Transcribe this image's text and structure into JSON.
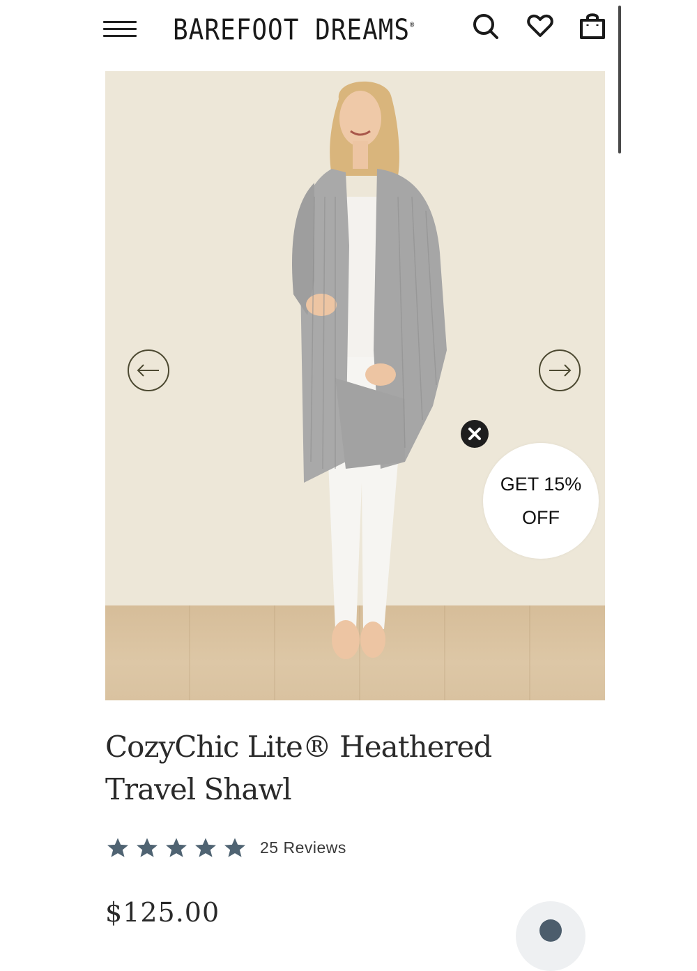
{
  "header": {
    "brand": "BAREFOOT DREAMS",
    "brand_mark": "®",
    "icons": [
      "menu-icon",
      "search-icon",
      "heart-icon",
      "shopping-bag-icon"
    ]
  },
  "hero": {
    "image_alt": "Model wearing CozyChic Lite Heathered Travel Shawl",
    "prev_icon": "arrow-left-icon",
    "next_icon": "arrow-right-icon"
  },
  "promo": {
    "line1": "GET 15%",
    "line2": "OFF",
    "close_icon": "close-icon"
  },
  "product": {
    "title": "CozyChic Lite® Heathered Travel Shawl",
    "rating_stars": 5,
    "reviews": "25 Reviews",
    "price": "$125.00"
  },
  "colors": {
    "star": "#4f6372",
    "arrow_border": "#4d4a32",
    "backdrop": "#ede7d8",
    "floor": "#d8c09d"
  }
}
